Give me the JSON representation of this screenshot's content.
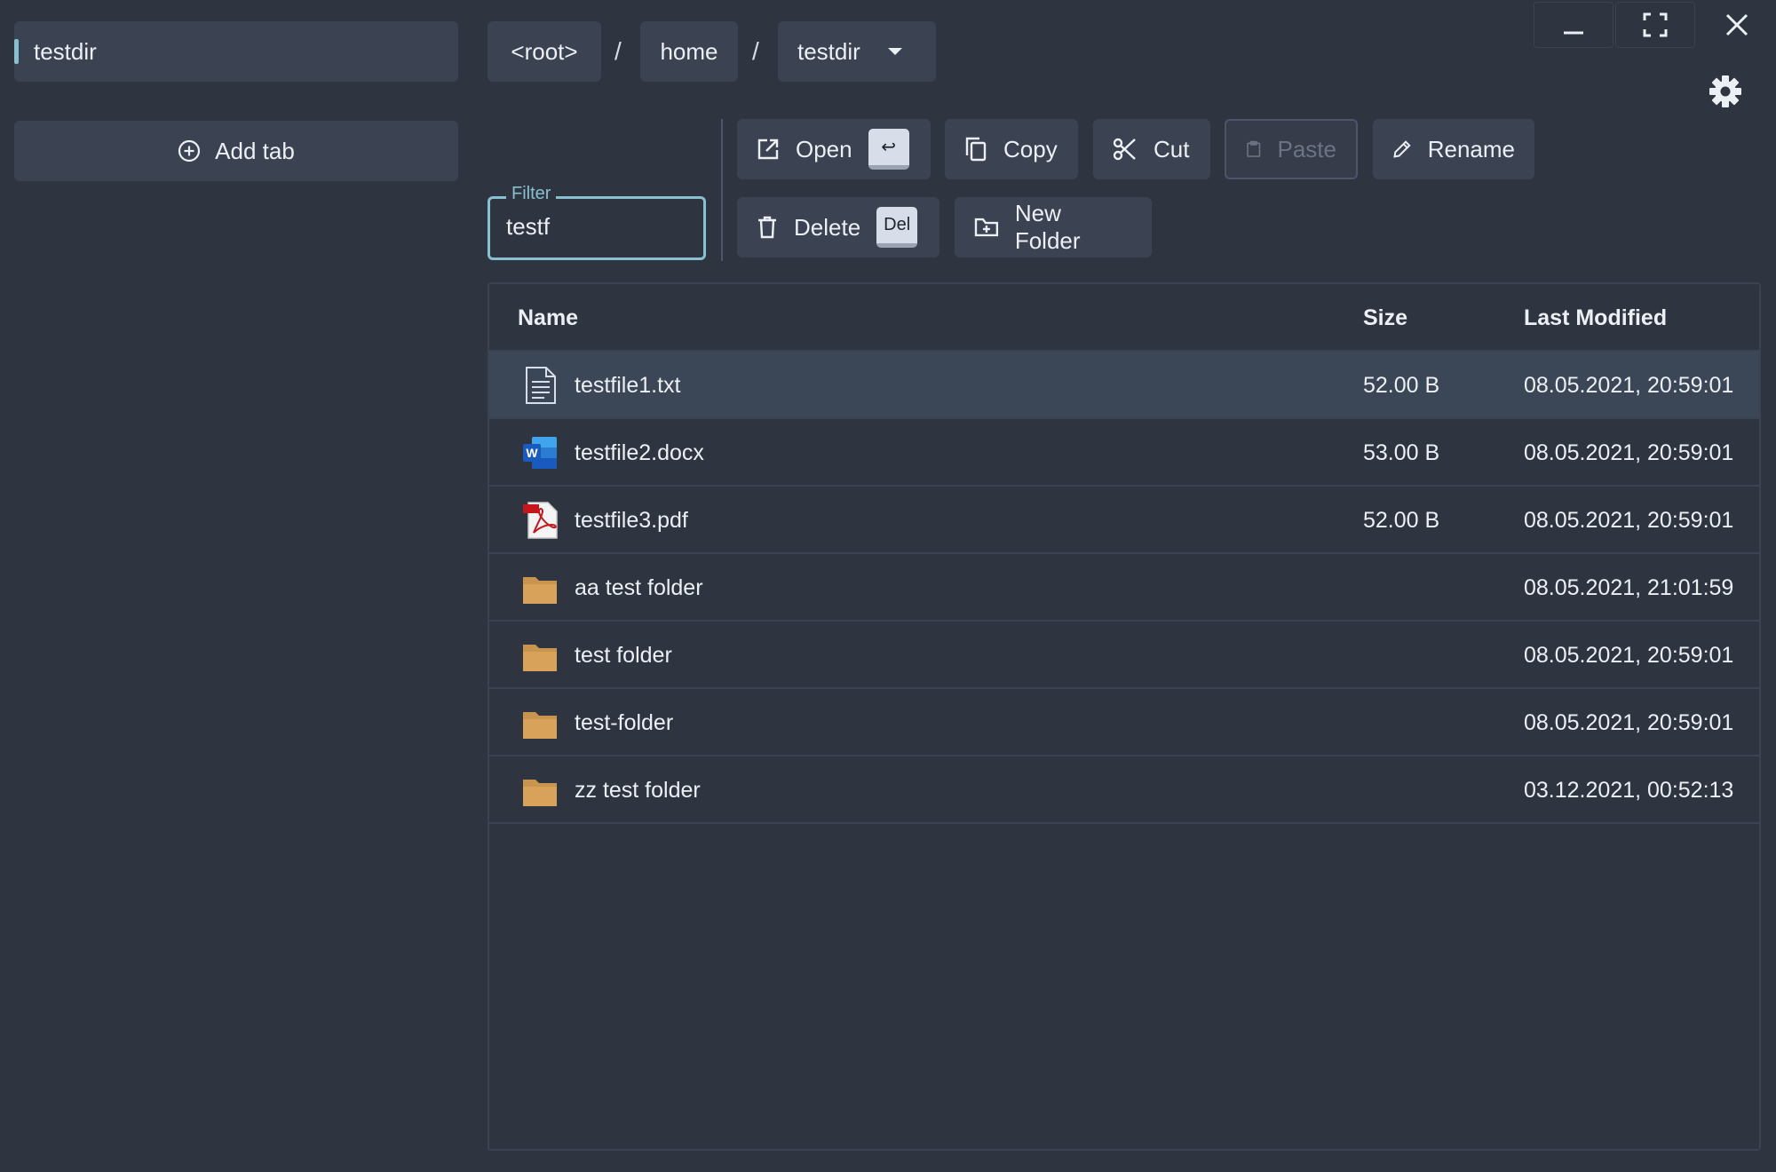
{
  "sidebar": {
    "active_tab": "testdir",
    "add_tab_label": "Add tab"
  },
  "breadcrumb": {
    "items": [
      "<root>",
      "home",
      "testdir"
    ],
    "separator": "/"
  },
  "filter": {
    "label": "Filter",
    "value": "testf"
  },
  "actions": {
    "open": "Open",
    "open_key": "↩",
    "copy": "Copy",
    "cut": "Cut",
    "paste": "Paste",
    "rename": "Rename",
    "delete": "Delete",
    "delete_key": "Del",
    "new_folder": "New Folder"
  },
  "table": {
    "columns": {
      "name": "Name",
      "size": "Size",
      "modified": "Last Modified"
    },
    "rows": [
      {
        "icon": "text-file-icon",
        "name": "testfile1.txt",
        "size": "52.00 B",
        "modified": "08.05.2021, 20:59:01",
        "selected": true
      },
      {
        "icon": "word-doc-icon",
        "name": "testfile2.docx",
        "size": "53.00 B",
        "modified": "08.05.2021, 20:59:01"
      },
      {
        "icon": "pdf-file-icon",
        "name": "testfile3.pdf",
        "size": "52.00 B",
        "modified": "08.05.2021, 20:59:01"
      },
      {
        "icon": "folder-icon",
        "name": "aa test folder",
        "size": "",
        "modified": "08.05.2021, 21:01:59"
      },
      {
        "icon": "folder-icon",
        "name": "test folder",
        "size": "",
        "modified": "08.05.2021, 20:59:01"
      },
      {
        "icon": "folder-icon",
        "name": "test-folder",
        "size": "",
        "modified": "08.05.2021, 20:59:01"
      },
      {
        "icon": "folder-icon",
        "name": "zz test folder",
        "size": "",
        "modified": "03.12.2021, 00:52:13"
      }
    ]
  },
  "colors": {
    "background": "#2e3440",
    "surface": "#3b4252",
    "accent": "#88c0d0",
    "folder": "#c9954e"
  }
}
